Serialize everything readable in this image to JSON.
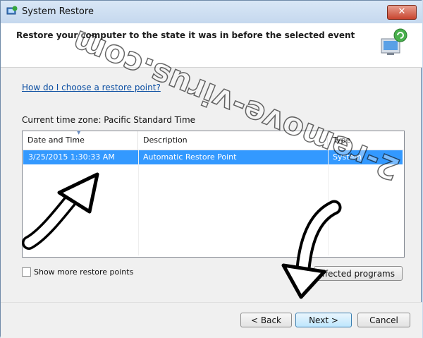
{
  "window": {
    "title": "System Restore",
    "close_glyph": "✕"
  },
  "header": {
    "title": "Restore your computer to the state it was in before the selected event",
    "icon": "system-restore-icon"
  },
  "help_link": "How do I choose a restore point?",
  "timezone_label": "Current time zone: Pacific Standard Time",
  "table": {
    "columns": [
      "Date and Time",
      "Description",
      "Type"
    ],
    "rows": [
      {
        "date": "3/25/2015 1:30:33 AM",
        "description": "Automatic Restore Point",
        "type": "System",
        "selected": true
      }
    ]
  },
  "show_more_label": "Show more restore points",
  "scan_button_label": "affected programs",
  "buttons": {
    "back": "< Back",
    "next": "Next >",
    "cancel": "Cancel"
  },
  "watermark": "2-remove-virus.com",
  "colors": {
    "selection": "#3399ff",
    "link": "#0b4ea2",
    "close": "#c8452f"
  }
}
